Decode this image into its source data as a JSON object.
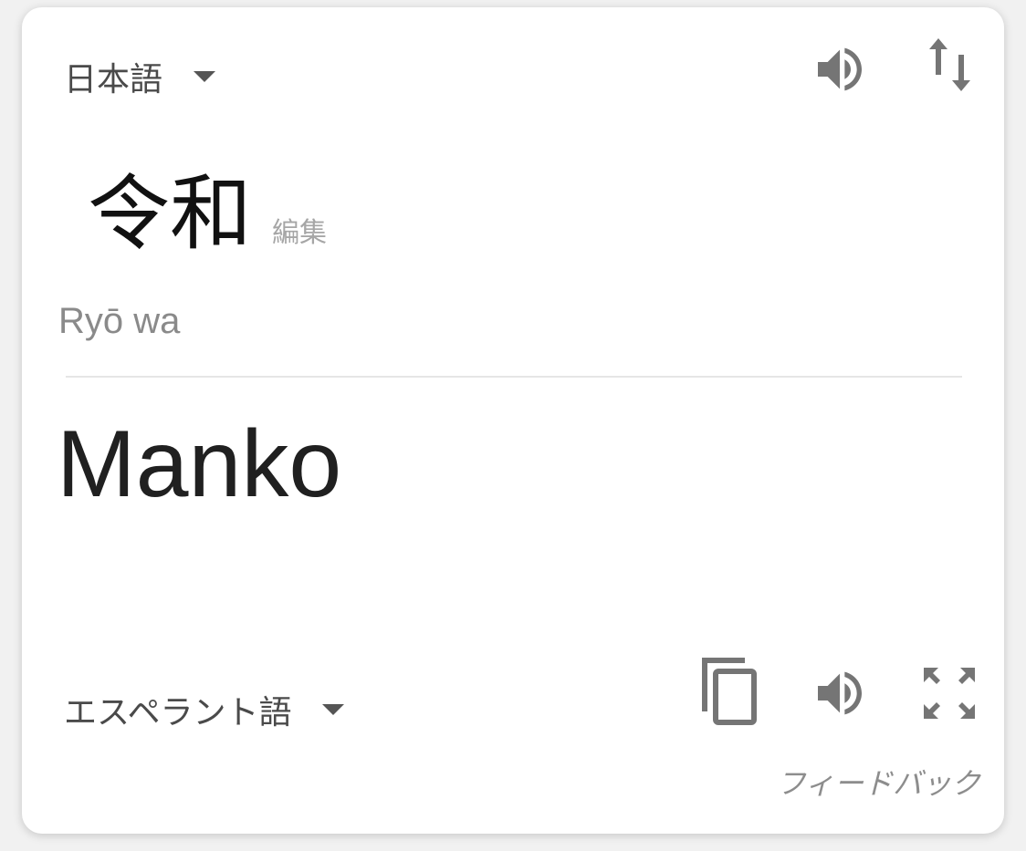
{
  "source": {
    "language": "日本語",
    "text": "令和",
    "edit_label": "編集",
    "romanization": "Ryō wa"
  },
  "target": {
    "language": "エスペラント語",
    "text": "Manko"
  },
  "feedback_label": "フィードバック",
  "icons": {
    "source_speaker": "speaker-icon",
    "swap": "swap-languages-icon",
    "copy": "copy-icon",
    "target_speaker": "speaker-icon",
    "fullscreen": "fullscreen-icon",
    "dropdown": "chevron-down-icon"
  },
  "colors": {
    "icon": "#757575",
    "text_primary": "#202020",
    "text_secondary": "#8a8a8a"
  }
}
